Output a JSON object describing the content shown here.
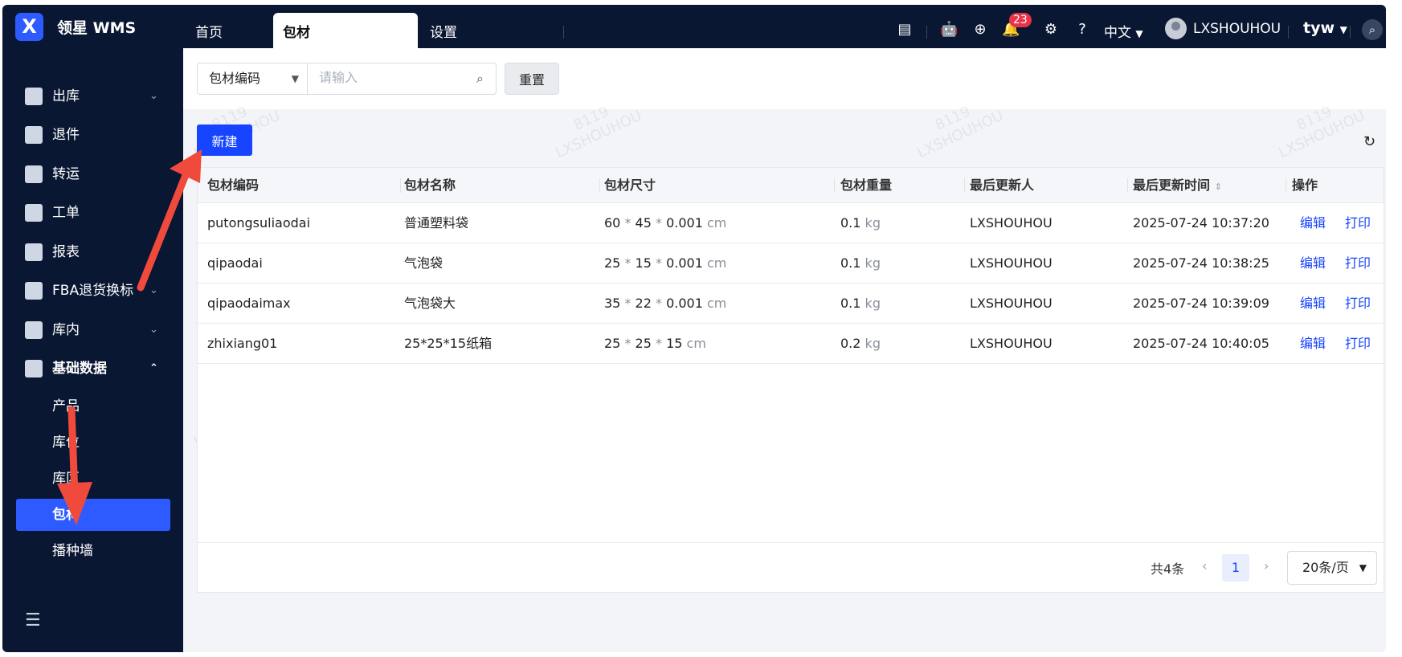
{
  "app": {
    "brand": "领星 WMS",
    "logo_letter": "X",
    "tabs": [
      {
        "label": "首页"
      },
      {
        "label": "包材"
      },
      {
        "label": "设置"
      }
    ],
    "notification_count": "23",
    "language": "中文",
    "username": "LXSHOUHOU",
    "account": "tyw"
  },
  "sidebar": {
    "items": [
      {
        "label": "出库",
        "chevron": "⌄"
      },
      {
        "label": "退件"
      },
      {
        "label": "转运"
      },
      {
        "label": "工单"
      },
      {
        "label": "报表"
      },
      {
        "label": "FBA退货换标",
        "chevron": "⌄"
      },
      {
        "label": "库内",
        "chevron": "⌄"
      },
      {
        "label": "基础数据",
        "chevron": "⌃"
      }
    ],
    "subitems": [
      {
        "label": "产品"
      },
      {
        "label": "库位"
      },
      {
        "label": "库区"
      },
      {
        "label": "包材"
      },
      {
        "label": "播种墙"
      }
    ]
  },
  "toolbar": {
    "filter_select": "包材编码",
    "search_placeholder": "请输入",
    "reset_label": "重置",
    "new_label": "新建"
  },
  "table": {
    "headers": [
      "包材编码",
      "包材名称",
      "包材尺寸",
      "包材重量",
      "最后更新人",
      "最后更新时间",
      "操作"
    ],
    "rows": [
      {
        "code": "putongsuliaodai",
        "name": "普通塑料袋",
        "l": "60",
        "w": "45",
        "h": "0.001",
        "size_unit": "cm",
        "weight": "0.1",
        "weight_unit": "kg",
        "updater": "LXSHOUHOU",
        "time": "2025-07-24 10:37:20",
        "edit": "编辑",
        "print": "打印"
      },
      {
        "code": "qipaodai",
        "name": "气泡袋",
        "l": "25",
        "w": "15",
        "h": "0.001",
        "size_unit": "cm",
        "weight": "0.1",
        "weight_unit": "kg",
        "updater": "LXSHOUHOU",
        "time": "2025-07-24 10:38:25",
        "edit": "编辑",
        "print": "打印"
      },
      {
        "code": "qipaodaimax",
        "name": "气泡袋大",
        "l": "35",
        "w": "22",
        "h": "0.001",
        "size_unit": "cm",
        "weight": "0.1",
        "weight_unit": "kg",
        "updater": "LXSHOUHOU",
        "time": "2025-07-24 10:39:09",
        "edit": "编辑",
        "print": "打印"
      },
      {
        "code": "zhixiang01",
        "name": "25*25*15纸箱",
        "l": "25",
        "w": "25",
        "h": "15",
        "size_unit": "cm",
        "weight": "0.2",
        "weight_unit": "kg",
        "updater": "LXSHOUHOU",
        "time": "2025-07-24 10:40:05",
        "edit": "编辑",
        "print": "打印"
      }
    ]
  },
  "pagination": {
    "total": "共4条",
    "current": "1",
    "page_size": "20条/页"
  },
  "watermark": {
    "line1": "8119",
    "line2": "LXSHOUHOU"
  },
  "colors": {
    "nav_bg": "#0a1733",
    "accent": "#1745ff",
    "annotation_arrow": "#f04a3c"
  }
}
